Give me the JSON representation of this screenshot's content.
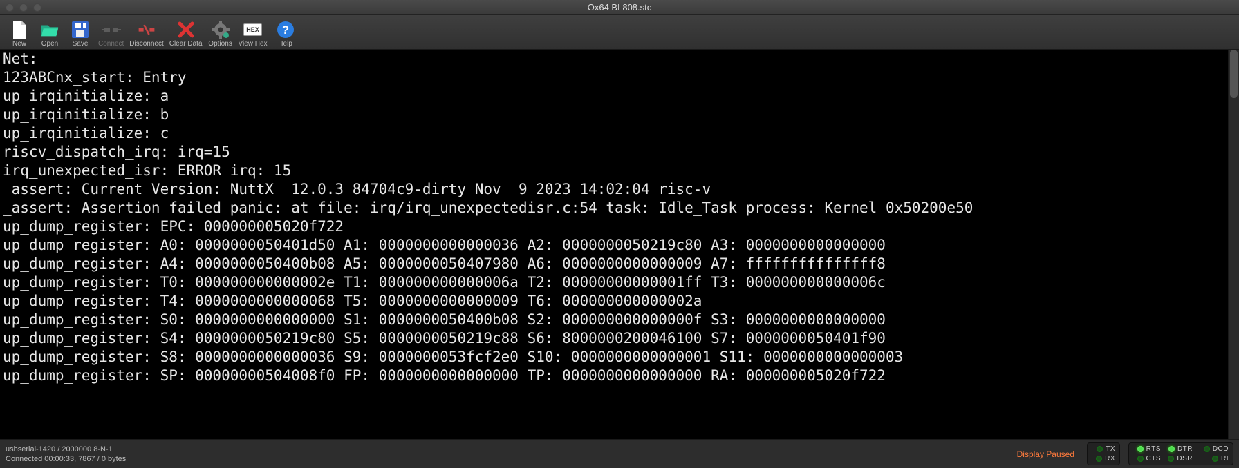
{
  "window": {
    "title": "Ox64 BL808.stc"
  },
  "toolbar": {
    "new": "New",
    "open": "Open",
    "save": "Save",
    "connect": "Connect",
    "disconnect": "Disconnect",
    "clear_data": "Clear Data",
    "options": "Options",
    "view_hex": "View Hex",
    "hex_badge": "HEX",
    "help": "Help"
  },
  "terminal": {
    "lines": [
      "Net:",
      "123ABCnx_start: Entry",
      "up_irqinitialize: a",
      "up_irqinitialize: b",
      "up_irqinitialize: c",
      "riscv_dispatch_irq: irq=15",
      "irq_unexpected_isr: ERROR irq: 15",
      "_assert: Current Version: NuttX  12.0.3 84704c9-dirty Nov  9 2023 14:02:04 risc-v",
      "_assert: Assertion failed panic: at file: irq/irq_unexpectedisr.c:54 task: Idle_Task process: Kernel 0x50200e50",
      "up_dump_register: EPC: 000000005020f722",
      "up_dump_register: A0: 0000000050401d50 A1: 0000000000000036 A2: 0000000050219c80 A3: 0000000000000000",
      "up_dump_register: A4: 0000000050400b08 A5: 0000000050407980 A6: 0000000000000009 A7: fffffffffffffff8",
      "up_dump_register: T0: 000000000000002e T1: 000000000000006a T2: 00000000000001ff T3: 000000000000006c",
      "up_dump_register: T4: 0000000000000068 T5: 0000000000000009 T6: 000000000000002a",
      "up_dump_register: S0: 0000000000000000 S1: 0000000050400b08 S2: 000000000000000f S3: 0000000000000000",
      "up_dump_register: S4: 0000000050219c80 S5: 0000000050219c88 S6: 8000000200046100 S7: 0000000050401f90",
      "up_dump_register: S8: 0000000000000036 S9: 0000000053fcf2e0 S10: 0000000000000001 S11: 0000000000000003",
      "up_dump_register: SP: 00000000504008f0 FP: 0000000000000000 TP: 0000000000000000 RA: 000000005020f722"
    ]
  },
  "status": {
    "line1": "usbserial-1420 / 2000000 8-N-1",
    "line2": "Connected 00:00:33, 7867 / 0 bytes",
    "display_paused": "Display Paused",
    "leds": {
      "tx": "TX",
      "rx": "RX",
      "rts": "RTS",
      "cts": "CTS",
      "dtr": "DTR",
      "dsr": "DSR",
      "dcd": "DCD",
      "ri": "RI"
    }
  }
}
